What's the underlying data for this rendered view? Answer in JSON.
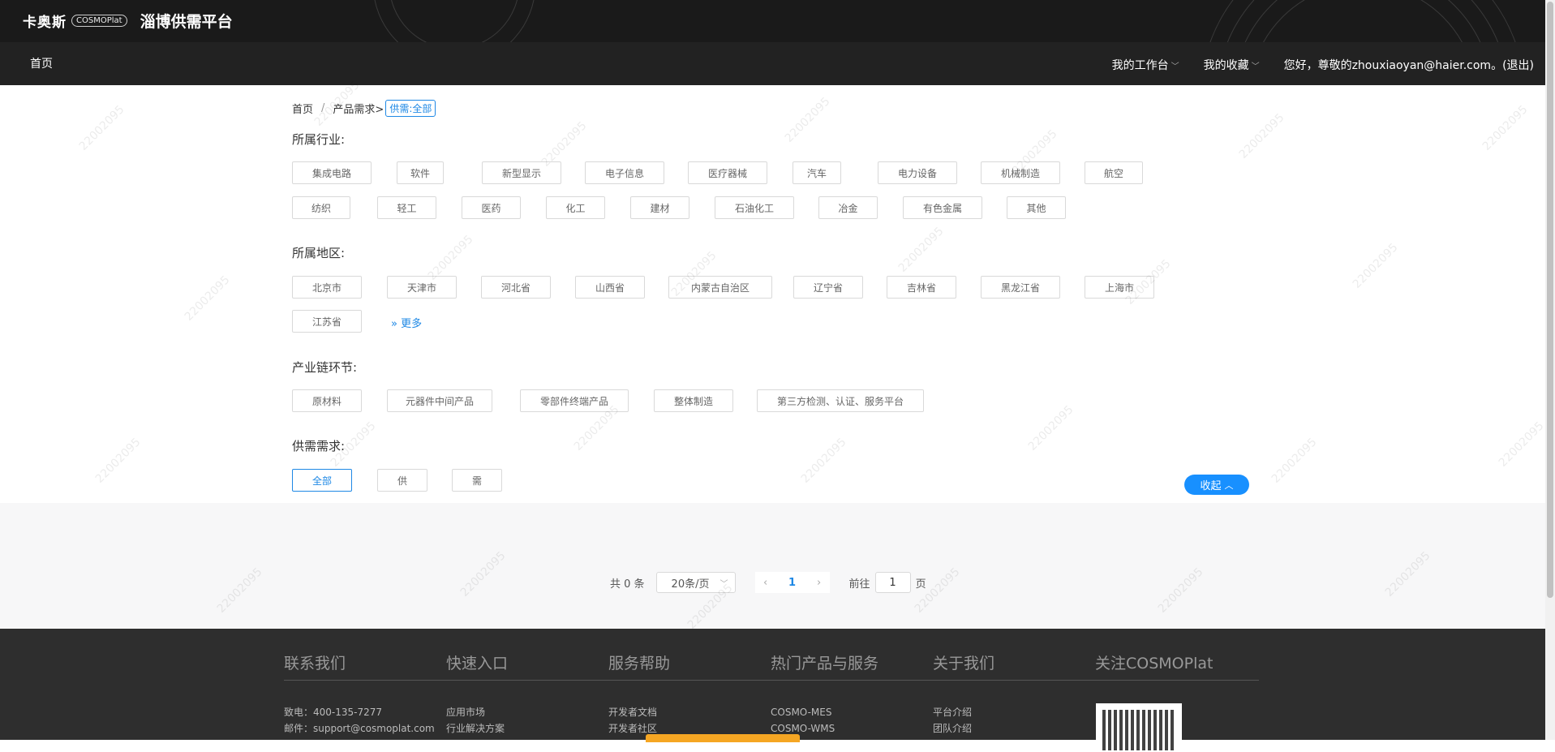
{
  "header": {
    "logo_text": "卡奥斯",
    "logo_badge": "COSMOPlat",
    "platform_title": "淄博供需平台"
  },
  "nav": {
    "home": "首页",
    "workbench": "我的工作台",
    "favorites": "我的收藏",
    "greeting": "您好，尊敬的zhouxiaoyan@haier.com。(退出)"
  },
  "breadcrumb": {
    "home": "首页",
    "slash": "/",
    "current": "产品需求>",
    "tag": "供需:全部"
  },
  "filters": {
    "industry": {
      "title": "所属行业:",
      "items": [
        "集成电路",
        "软件",
        "新型显示",
        "电子信息",
        "医疗器械",
        "汽车",
        "电力设备",
        "机械制造",
        "航空",
        "纺织",
        "轻工",
        "医药",
        "化工",
        "建材",
        "石油化工",
        "冶金",
        "有色金属",
        "其他"
      ]
    },
    "region": {
      "title": "所属地区:",
      "items": [
        "北京市",
        "天津市",
        "河北省",
        "山西省",
        "内蒙古自治区",
        "辽宁省",
        "吉林省",
        "黑龙江省",
        "上海市",
        "江苏省"
      ],
      "more": "更多"
    },
    "chain": {
      "title": "产业链环节:",
      "items": [
        "原材料",
        "元器件中间产品",
        "零部件终端产品",
        "整体制造",
        "第三方检测、认证、服务平台"
      ]
    },
    "supply": {
      "title": "供需需求:",
      "items": [
        "全部",
        "供",
        "需"
      ],
      "selected": "全部"
    },
    "collapse_label": "收起"
  },
  "pagination": {
    "total": "共 0 条",
    "page_size": "20条/页",
    "current_page": "1",
    "goto_label": "前往",
    "goto_value": "1",
    "page_unit": "页"
  },
  "footer": {
    "columns": [
      {
        "title": "联系我们",
        "links": [
          "致电：400-135-7277",
          "邮件：support@cosmoplat.com"
        ]
      },
      {
        "title": "快速入口",
        "links": [
          "应用市场",
          "行业解决方案"
        ]
      },
      {
        "title": "服务帮助",
        "links": [
          "开发者文档",
          "开发者社区"
        ]
      },
      {
        "title": "热门产品与服务",
        "links": [
          "COSMO-MES",
          "COSMO-WMS"
        ]
      },
      {
        "title": "关于我们",
        "links": [
          "平台介绍",
          "团队介绍"
        ]
      },
      {
        "title": "关注COSMOPlat",
        "links": []
      }
    ]
  },
  "watermark": "22002095",
  "colors": {
    "accent": "#1890ff",
    "header_bg": "#1a1a1a",
    "nav_bg": "#222222",
    "footer_bg": "#2e2e2e"
  }
}
